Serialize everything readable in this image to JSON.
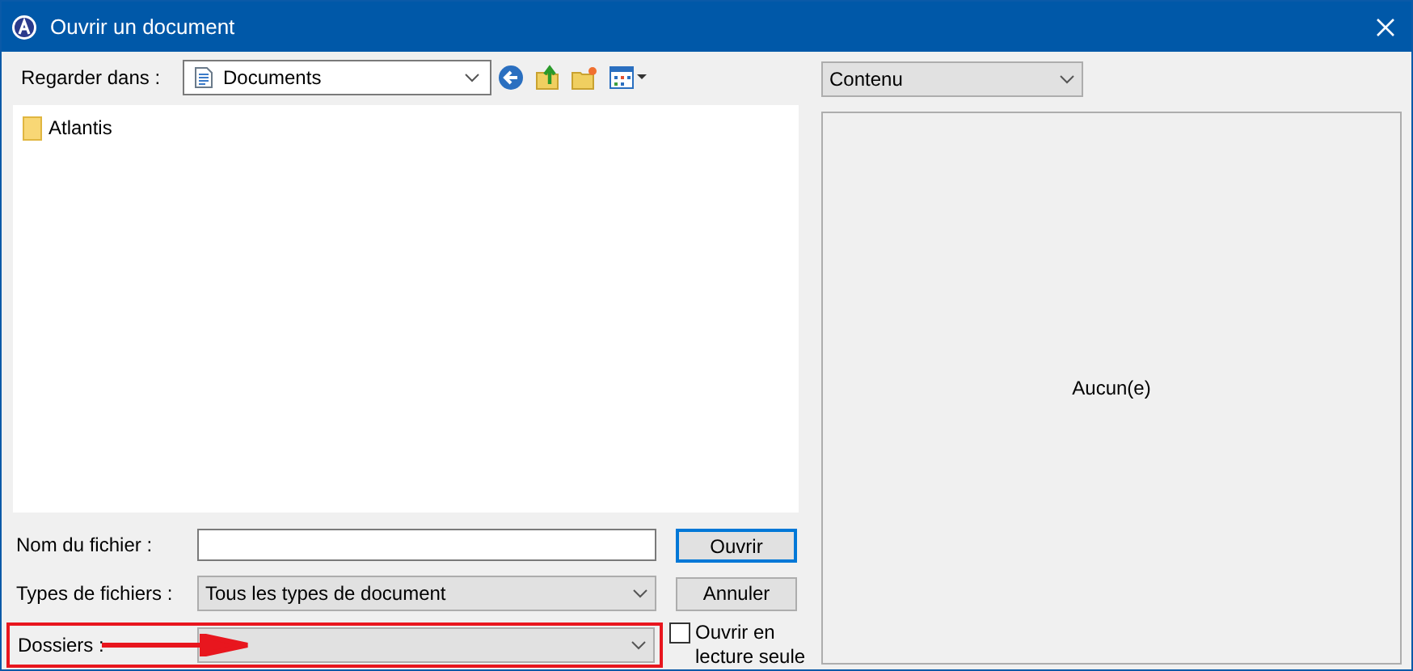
{
  "window": {
    "title": "Ouvrir un document"
  },
  "look_in": {
    "label": "Regarder dans :",
    "value": "Documents"
  },
  "files": [
    {
      "name": "Atlantis"
    }
  ],
  "file_name": {
    "label": "Nom du fichier :"
  },
  "file_types": {
    "label": "Types de fichiers :",
    "value": "Tous les types de document"
  },
  "folders": {
    "label": "Dossiers :",
    "highlighted": true
  },
  "buttons": [
    {
      "label": "Ouvrir",
      "default": true
    },
    {
      "label": "Annuler",
      "default": false
    }
  ],
  "read_only": {
    "label": "Ouvrir en lecture seule",
    "checked": false
  },
  "preview": {
    "mode": "Contenu",
    "message": "Aucun(e)"
  }
}
